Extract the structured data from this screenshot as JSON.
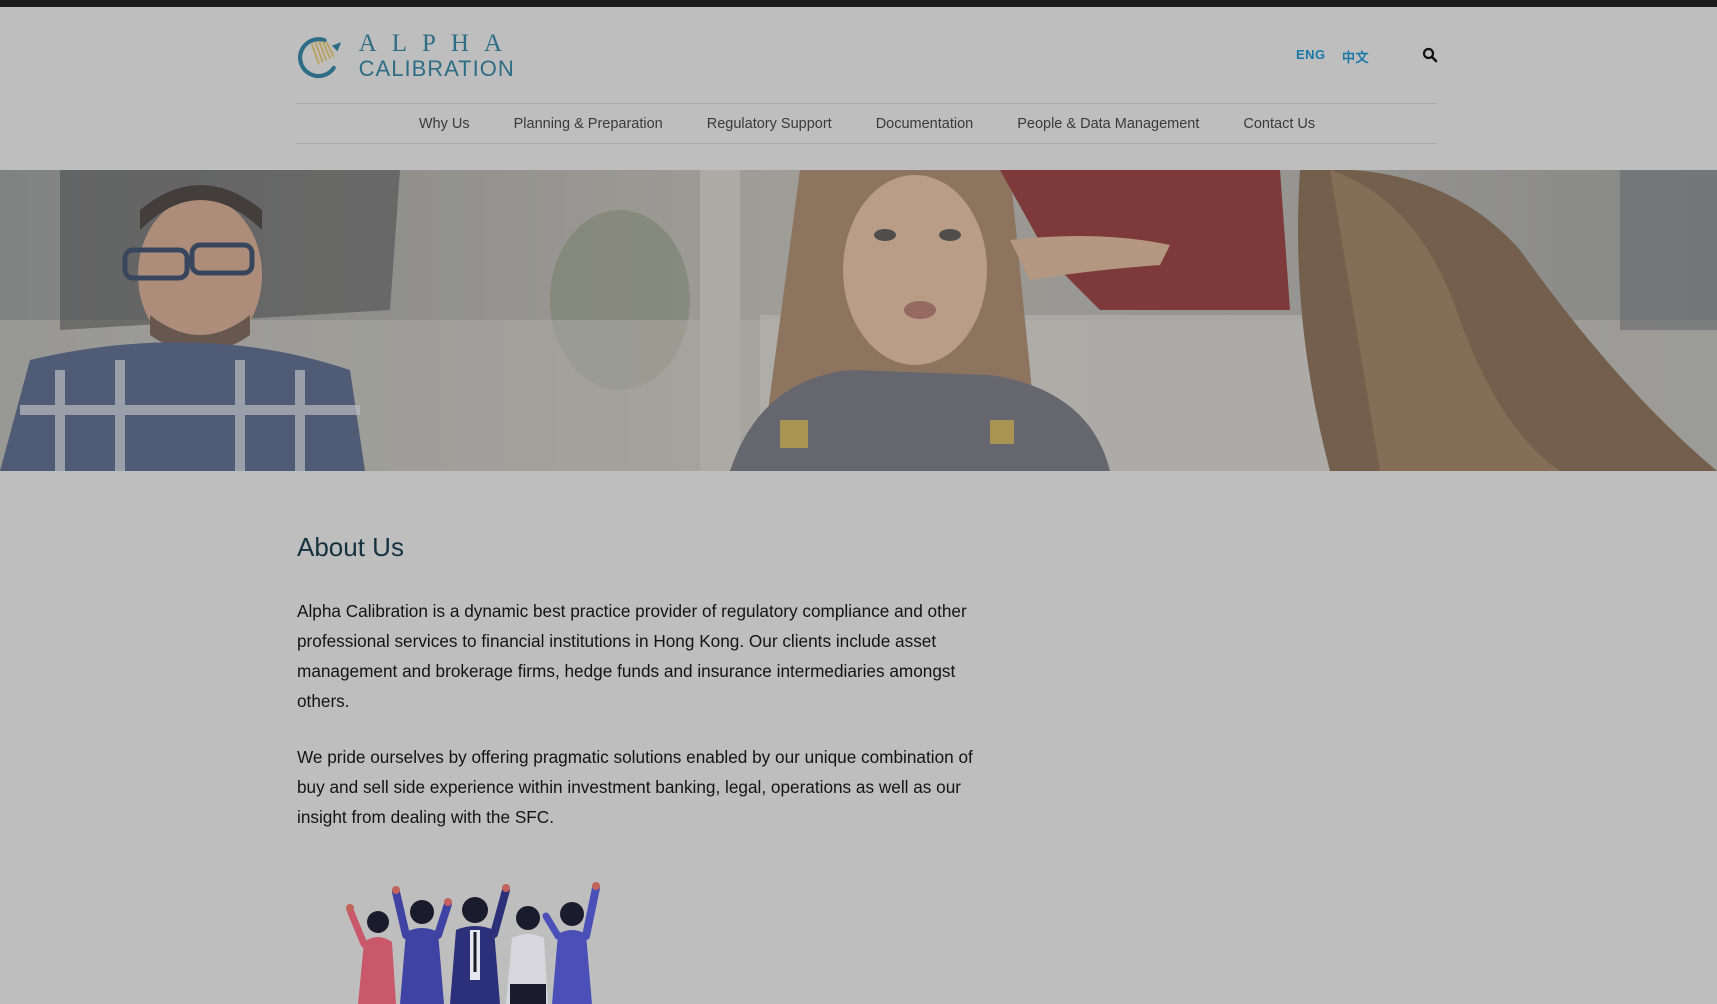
{
  "header": {
    "logo_line1": "ALPHA",
    "logo_line2": "CALIBRATION",
    "lang_english": "ENG",
    "lang_chinese": "中文"
  },
  "nav": {
    "items": [
      {
        "label": "Why Us"
      },
      {
        "label": "Planning & Preparation"
      },
      {
        "label": "Regulatory Support"
      },
      {
        "label": "Documentation"
      },
      {
        "label": "People & Data Management"
      },
      {
        "label": "Contact Us"
      }
    ]
  },
  "icons": {
    "search": "search-icon",
    "logo": "logo-icon"
  },
  "main": {
    "title": "About Us",
    "paragraph1": "Alpha Calibration is a dynamic best practice provider of regulatory compliance and other professional services to financial institutions in Hong Kong. Our clients include asset management and brokerage firms, hedge funds and insurance intermediaries amongst others.",
    "paragraph2": "We pride ourselves by offering pragmatic solutions enabled by our unique combination of buy and sell side experience within investment banking, legal, operations as well as our insight from dealing with the SFC."
  },
  "colors": {
    "brand_blue": "#2e6d86",
    "link_blue": "#1878a8",
    "logo_gold": "#b9a15c",
    "heading": "#14323f"
  }
}
